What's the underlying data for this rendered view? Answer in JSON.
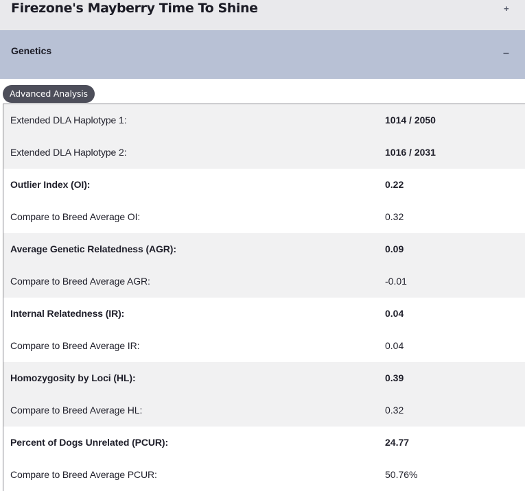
{
  "header": {
    "title": "Firezone's Mayberry Time To Shine",
    "toggle": "+"
  },
  "section": {
    "label": "Genetics",
    "toggle": "–"
  },
  "tab": {
    "label": "Advanced Analysis"
  },
  "rows": [
    {
      "label": "Extended DLA Haplotype 1:",
      "value": "1014 / 2050"
    },
    {
      "label": "Extended DLA Haplotype 2:",
      "value": "1016 / 2031"
    },
    {
      "label": "Outlier Index (OI):",
      "value": "0.22"
    },
    {
      "label": "Compare to Breed Average OI:",
      "value": "0.32"
    },
    {
      "label": "Average Genetic Relatedness (AGR):",
      "value": "0.09"
    },
    {
      "label": "Compare to Breed Average AGR:",
      "value": "-0.01"
    },
    {
      "label": "Internal Relatedness (IR):",
      "value": "0.04"
    },
    {
      "label": "Compare to Breed Average IR:",
      "value": "0.04"
    },
    {
      "label": "Homozygosity by Loci (HL):",
      "value": "0.39"
    },
    {
      "label": "Compare to Breed Average HL:",
      "value": "0.32"
    },
    {
      "label": "Percent of Dogs Unrelated (PCUR):",
      "value": "24.77"
    },
    {
      "label": "Compare to Breed Average PCUR:",
      "value": "50.76%"
    }
  ]
}
